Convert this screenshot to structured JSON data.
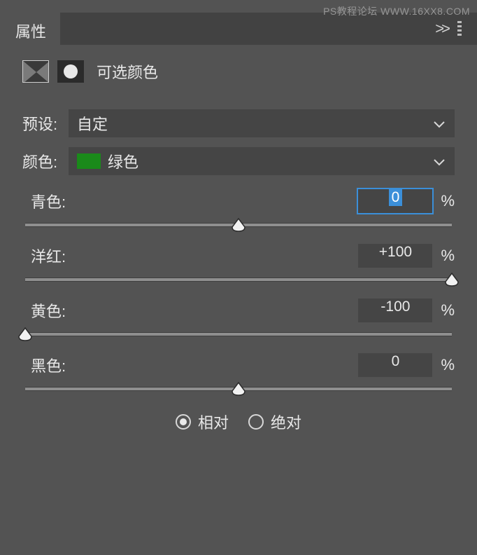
{
  "watermark": "PS教程论坛  WWW.16XX8.COM",
  "panel": {
    "tab_title": "属性",
    "adjustment_title": "可选颜色"
  },
  "preset": {
    "label": "预设:",
    "value": "自定"
  },
  "colors": {
    "label": "颜色:",
    "selected": "绿色",
    "swatch": "#1a8a1a"
  },
  "sliders": {
    "cyan": {
      "label": "青色:",
      "value": "0",
      "pos": 50,
      "focused": true
    },
    "magenta": {
      "label": "洋红:",
      "value": "+100",
      "pos": 100,
      "focused": false
    },
    "yellow": {
      "label": "黄色:",
      "value": "-100",
      "pos": 0,
      "focused": false
    },
    "black": {
      "label": "黑色:",
      "value": "0",
      "pos": 50,
      "focused": false
    }
  },
  "method": {
    "relative": "相对",
    "absolute": "绝对",
    "selected": "relative"
  },
  "percent": "%"
}
